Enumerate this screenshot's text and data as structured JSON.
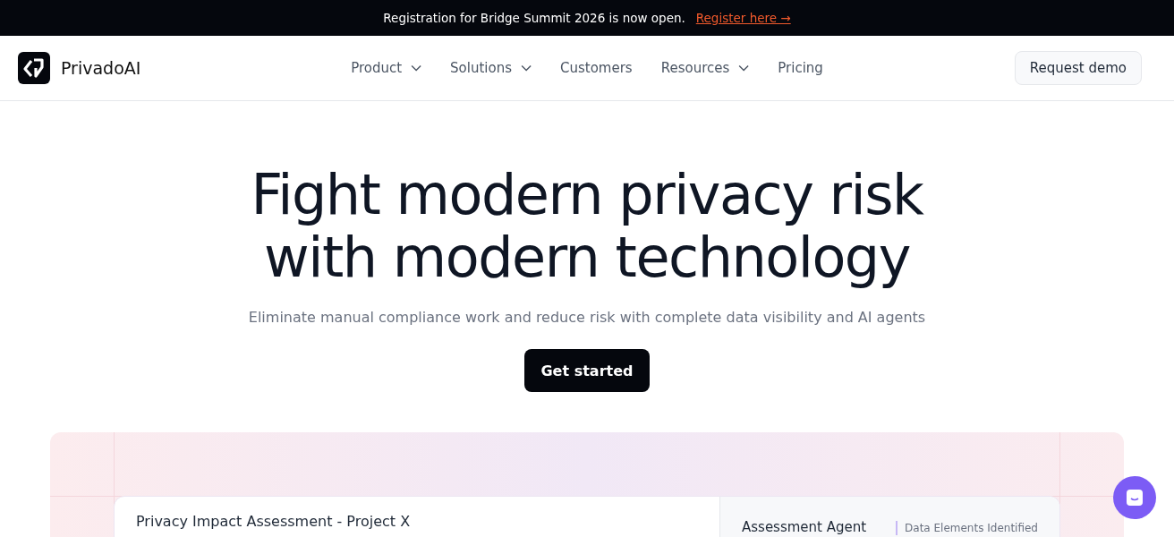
{
  "announcement": {
    "text": "Registration for Bridge Summit 2026 is now open.",
    "link": "Register here →"
  },
  "nav": {
    "brand": "PrivadoAI",
    "items": [
      {
        "label": "Product",
        "has_menu": true
      },
      {
        "label": "Solutions",
        "has_menu": true
      },
      {
        "label": "Customers",
        "has_menu": false
      },
      {
        "label": "Resources",
        "has_menu": true
      },
      {
        "label": "Pricing",
        "has_menu": false
      }
    ],
    "cta": "Request demo"
  },
  "hero": {
    "title_lines": [
      "Fight modern privacy risk",
      "with modern technology"
    ],
    "subtitle": "Eliminate manual compliance work and reduce risk with complete data visibility and AI agents",
    "button": "Get started"
  },
  "preview": {
    "title": "Privacy Impact Assessment - Project X",
    "agent": "Assessment Agent",
    "status": "Data Elements Identified"
  }
}
